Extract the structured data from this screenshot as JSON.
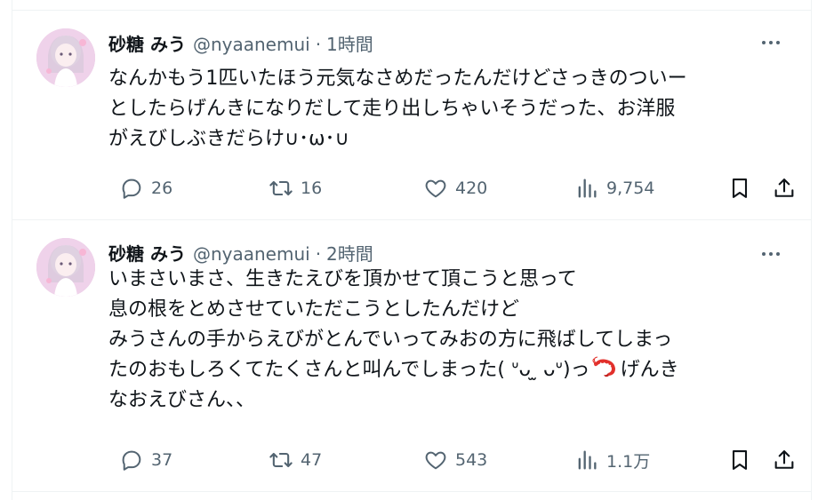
{
  "tweets": [
    {
      "name": "砂糖 みう",
      "handle": "@nyaanemui",
      "separator": "·",
      "time": "1時間",
      "lines": [
        "なんかもう1匹いたほう元気なさめだったんだけどさっきのついー",
        "としたらげんきになりだして走り出しちゃいそうだった、お洋服",
        "がえびしぶきだらけ∪･ω･∪"
      ],
      "stats": {
        "replies": "26",
        "retweets": "16",
        "likes": "420",
        "views": "9,754"
      }
    },
    {
      "name": "砂糖 みう",
      "handle": "@nyaanemui",
      "separator": "·",
      "time": "2時間",
      "lines": [
        "いまさいまさ、生きたえびを頂かせて頂こうと思って",
        "息の根をとめさせていただこうとしたんだけど",
        "みうさんの手からえびがとんでいってみおの方に飛ばしてしまっ",
        "たのおもしろくてたくさんと叫んでしまった( ᐡᴗ ̫ ᴗᐡ)っ",
        "げんき",
        "なおえびさん、、"
      ],
      "stats": {
        "replies": "37",
        "retweets": "47",
        "likes": "543",
        "views": "1.1万"
      }
    }
  ],
  "icons": {
    "reply": "reply-icon",
    "retweet": "retweet-icon",
    "like": "heart-icon",
    "views": "views-icon",
    "bookmark": "bookmark-icon",
    "share": "share-icon",
    "more": "more-icon",
    "emoji": "shrimp-emoji-icon"
  },
  "colors": {
    "text": "#0f1419",
    "muted": "#536471",
    "border": "#eff3f4"
  }
}
